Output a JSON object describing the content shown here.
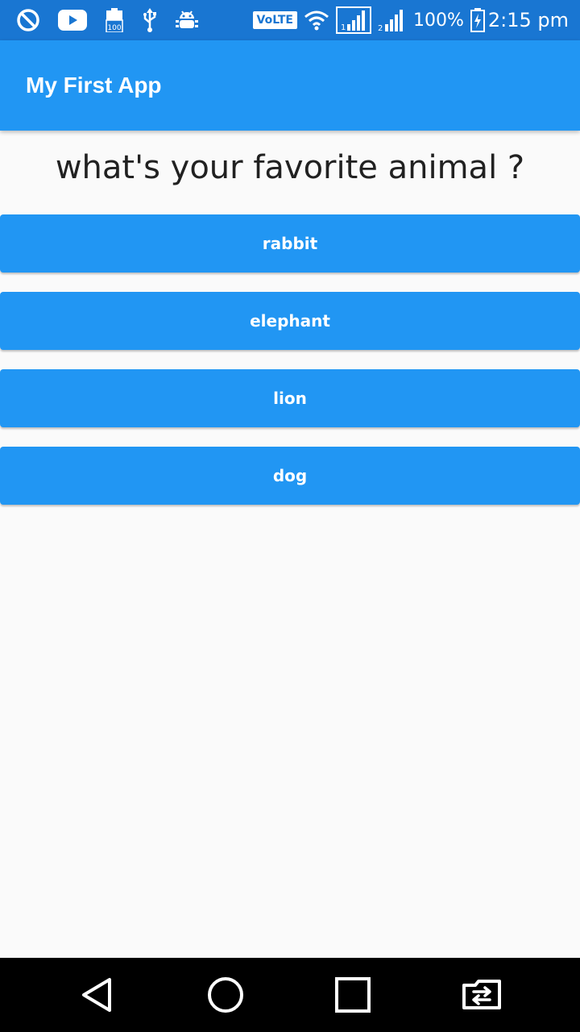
{
  "status_bar": {
    "icons_left": [
      "do-not-disturb-icon",
      "youtube-icon",
      "battery-100-icon",
      "usb-icon",
      "android-debug-icon"
    ],
    "volte_label": "VoLTE",
    "icons_right": [
      "wifi-icon",
      "signal-sim1-icon",
      "signal-sim2-icon",
      "battery-charging-icon"
    ],
    "battery_percent": "100%",
    "time": "2:15 pm"
  },
  "app_bar": {
    "title": "My First App"
  },
  "quiz": {
    "question": "what's your favorite animal ?",
    "answers": [
      "rabbit",
      "elephant",
      "lion",
      "dog"
    ]
  },
  "nav_bar": {
    "buttons": [
      "back-icon",
      "home-icon",
      "recents-icon",
      "screen-switch-icon"
    ]
  },
  "colors": {
    "status_bar": "#1976d2",
    "primary": "#2196f3",
    "background": "#fafafa",
    "text_dark": "#212121",
    "nav_bar": "#000000"
  }
}
